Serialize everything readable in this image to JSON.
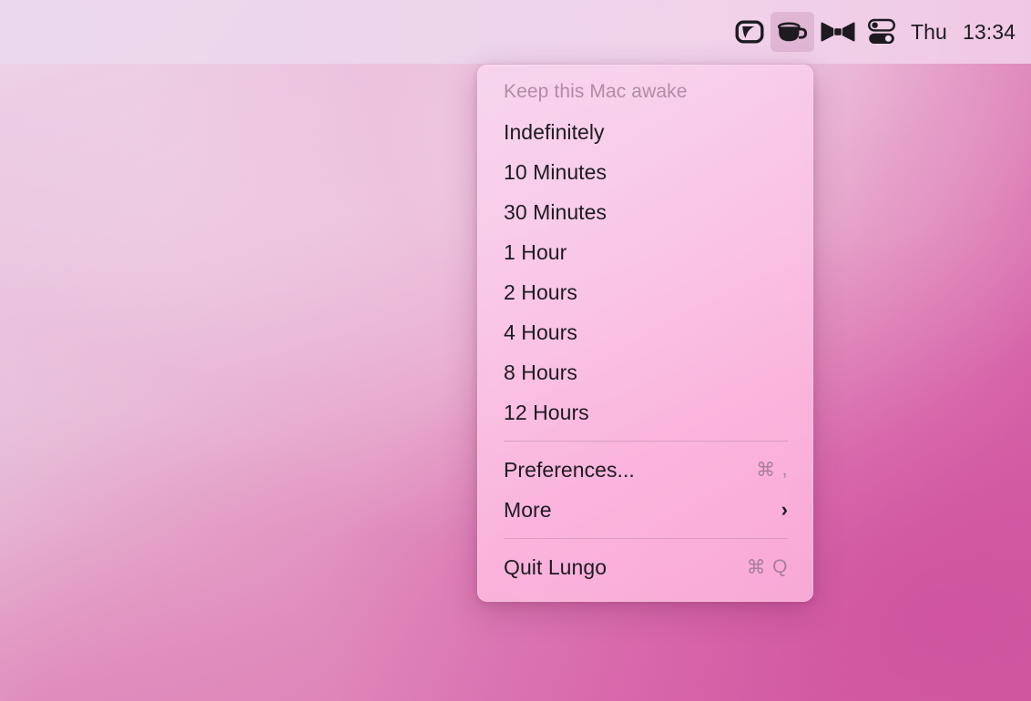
{
  "menubar": {
    "icons": [
      {
        "name": "lungo-app-icon",
        "active": false
      },
      {
        "name": "coffee-cup-icon",
        "active": true
      },
      {
        "name": "bowtie-icon",
        "active": false
      },
      {
        "name": "toggles-icon",
        "active": false
      }
    ],
    "clock": {
      "day": "Thu",
      "time": "13:34"
    }
  },
  "menu": {
    "header": "Keep this Mac awake",
    "duration_items": [
      {
        "label": "Indefinitely"
      },
      {
        "label": "10 Minutes"
      },
      {
        "label": "30 Minutes"
      },
      {
        "label": "1 Hour"
      },
      {
        "label": "2 Hours"
      },
      {
        "label": "4 Hours"
      },
      {
        "label": "8 Hours"
      },
      {
        "label": "12 Hours"
      }
    ],
    "preferences": {
      "label": "Preferences...",
      "shortcut_modifier": "⌘",
      "shortcut_key": ","
    },
    "more": {
      "label": "More",
      "chevron": "›"
    },
    "quit": {
      "label": "Quit Lungo",
      "shortcut_modifier": "⌘",
      "shortcut_key": "Q"
    }
  },
  "colors": {
    "menu_text": "#1d1b20",
    "menu_header_text": "#b08ca4",
    "shortcut_text": "#a87f9b",
    "separator": "#96 6e8c",
    "menubar_bg": "#ebd8ec",
    "panel_bg": "#f7cbe6",
    "wallpaper_light": "#ead7e8",
    "wallpaper_dark": "#cf5aa1",
    "active_icon_bg": "#cd96be"
  }
}
